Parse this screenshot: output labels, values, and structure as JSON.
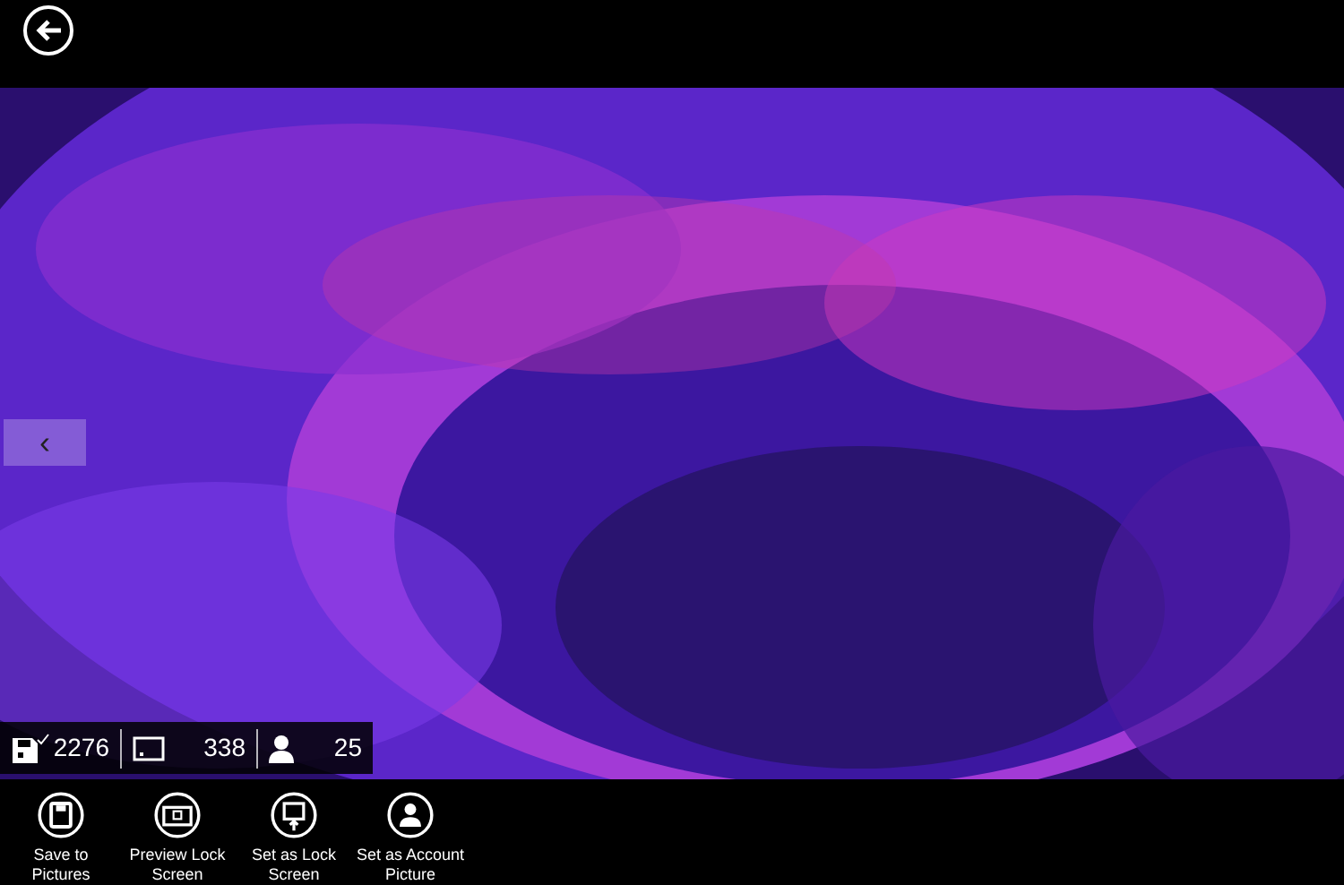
{
  "previous_button": {
    "glyph": "‹"
  },
  "stats": [
    {
      "kind": "saves",
      "value": "2276"
    },
    {
      "kind": "lockscreens",
      "value": "338"
    },
    {
      "kind": "accounts",
      "value": "25"
    }
  ],
  "app_bar": [
    {
      "kind": "save",
      "label": "Save to Pictures"
    },
    {
      "kind": "preview",
      "label": "Preview Lock Screen"
    },
    {
      "kind": "lock",
      "label": "Set as Lock Screen"
    },
    {
      "kind": "account",
      "label": "Set as Account Picture"
    }
  ]
}
